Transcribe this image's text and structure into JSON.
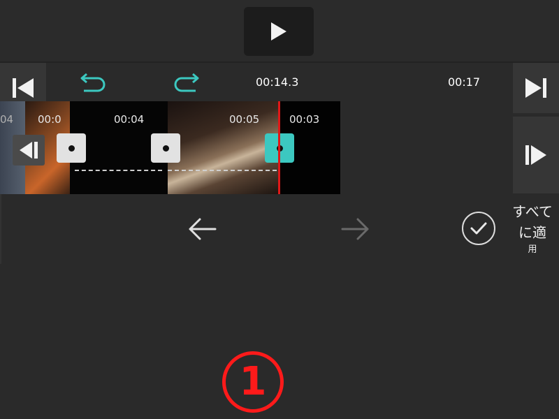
{
  "header": {
    "play_icon": "play-icon"
  },
  "timeline": {
    "current_time": "00:14.3",
    "total_time": "00:17",
    "clip_labels": [
      "00:0",
      "00:04",
      "00:05",
      "00:03"
    ],
    "truncated_left_label": "04"
  },
  "icons": {
    "jump_start": "skip-to-start-icon",
    "jump_end": "skip-to-end-icon",
    "prev_keyframe": "previous-keyframe-icon",
    "next_keyframe": "next-keyframe-icon",
    "undo": "undo-icon",
    "redo": "redo-icon",
    "back": "arrow-left-icon",
    "forward": "arrow-right-icon",
    "apply": "checkmark-icon"
  },
  "apply_all": {
    "line1": "すべて",
    "line2": "に適",
    "line3": "用"
  },
  "annotation": {
    "marker": "①"
  },
  "colors": {
    "accent": "#3cc8c0",
    "playhead": "#e01818",
    "annotation": "#ff1a1a"
  }
}
